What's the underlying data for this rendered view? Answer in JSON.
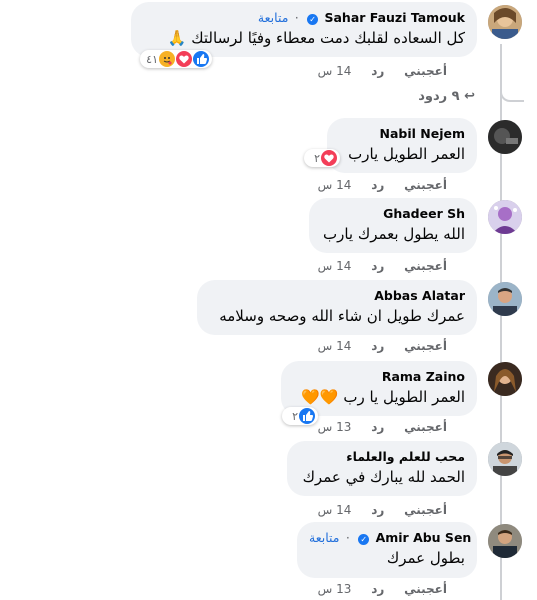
{
  "comments": [
    {
      "name": "Sahar Fauzi Tamouk",
      "follow": "متابعة",
      "text": "كل السعاده لقلبك دمت معطاء وفيًا لرسالتك 🙏",
      "like": "أعجبني",
      "reply": "رد",
      "time": "14 س",
      "reaction_count": "٤١",
      "replies": "٩ ردود"
    },
    {
      "name": "Nabil Nejem",
      "text": "العمر الطويل يارب",
      "like": "أعجبني",
      "reply": "رد",
      "time": "14 س",
      "reaction_count": "٢"
    },
    {
      "name": "Ghadeer Sh",
      "text": "الله يطول بعمرك يارب",
      "like": "أعجبني",
      "reply": "رد",
      "time": "14 س"
    },
    {
      "name": "Abbas Alatar",
      "text": "عمرك طويل ان شاء الله وصحه وسلامه",
      "like": "أعجبني",
      "reply": "رد",
      "time": "14 س"
    },
    {
      "name": "Rama Zaino",
      "text": "العمر الطويل يا رب 🧡🧡",
      "like": "أعجبني",
      "reply": "رد",
      "time": "13 س",
      "reaction_count": "٢"
    },
    {
      "name": "محب للعلم والعلماء",
      "text": "الحمد لله يبارك في عمرك",
      "like": "أعجبني",
      "reply": "رد",
      "time": "14 س"
    },
    {
      "name": "Amir Abu Sen",
      "follow": "متابعة",
      "text": "بطول عمرك",
      "like": "أعجبني",
      "reply": "رد",
      "time": "13 س"
    }
  ],
  "colors": {
    "bubble": "#f0f2f5",
    "link": "#216fdb",
    "like_blue": "#1877f2",
    "love_red": "#f33e58",
    "muted": "#65676b"
  }
}
